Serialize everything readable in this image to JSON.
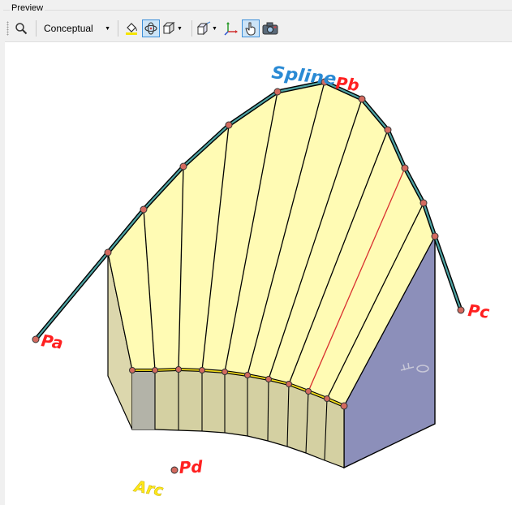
{
  "group": {
    "title": "Preview"
  },
  "toolbar": {
    "zoom_icon": "magnifier-icon",
    "visual_style": "Conceptual",
    "buttons": [
      "paint-bucket-icon",
      "orbit-icon",
      "box-view-icon",
      "projection-icon",
      "axes-icon",
      "hand-pointer-icon",
      "camera-icon"
    ]
  },
  "scene": {
    "labels": {
      "pa": "Pa",
      "pb": "Pb",
      "pc": "Pc",
      "pd": "Pd",
      "spline": "Spline",
      "arc": "Arc"
    },
    "colors": {
      "surface": "#fffbb4",
      "side": "#d6d2a6",
      "front_face": "#9094b8",
      "spline": "#2d6a73",
      "point": "#d46a5f",
      "label_red": "#ff2020",
      "label_blue": "#2a8ad4",
      "label_yellow": "#ffe81a"
    }
  }
}
